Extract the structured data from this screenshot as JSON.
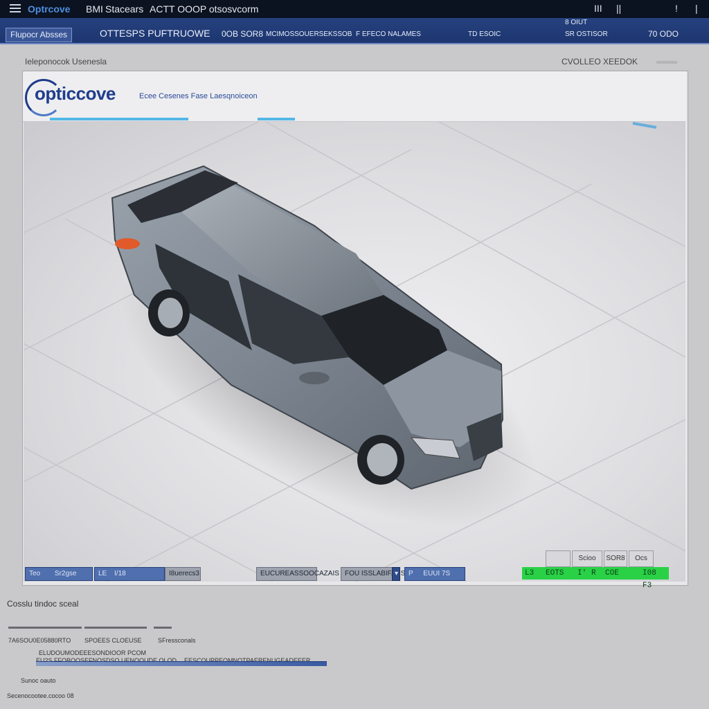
{
  "titlebar": {
    "app_name": "Optrcove",
    "menu_1": "BMI",
    "menu_2": "Stacears",
    "menu_3": "ACTT OOOP otsosvcorm",
    "controls": [
      "III",
      "||",
      "!",
      "|"
    ]
  },
  "toolbar": {
    "sub_status": "8 OIUT",
    "left_button": "Flupocr Absses",
    "title": "OTTESPS PUFTRUOWE",
    "item_1": "0OB SOR8",
    "item_2": "MCIMOSSOUERSEKSSOB",
    "item_3": "F EFECO NALAMES",
    "item_4": "TD ESOIC",
    "item_5": "SR OSTISOR",
    "item_6": "70 ODO"
  },
  "panel": {
    "title_left": "Ieleponocok Usenesla",
    "title_right": "CVOLLEO XEEDOK",
    "logo_word": "opticcove",
    "logo_tagline": "Ecee Cesenes Fase Laesqnoiceon"
  },
  "bottom_controls": {
    "c1_label": "Teo",
    "c1_value": "Sr2gse",
    "c2_label": "LE",
    "c2_value": "I/18",
    "c2_extra": "I8uerecs3",
    "c3": "EUCUREASSOOCAZAIS",
    "c4": "FOU ISSLABIFASS",
    "c5_label": "P",
    "c5_value": "EUUI 7S",
    "mini_1": "",
    "mini_2": "Scioo",
    "mini_3": "SOR8",
    "mini_4": "Ocs"
  },
  "green_status": {
    "a": "L3",
    "b": "EOTS",
    "c": "I'",
    "d": "R",
    "e": "COE",
    "f": "I08 F3"
  },
  "lower": {
    "title": "Cosslu tindoc sceal",
    "r1_c1": "7A6SOU0E05880RTO",
    "r1_c2": "SPOEES CLOEUSE",
    "r1_c3": "SFressconals",
    "r2": "ELUDOUMODEEESONDIOOR PCOM",
    "r3_left": "EU2S FFOBOOSEFNOSDSO UENOOUDE OLOD",
    "r3_right": "EESCOUPPEOMNOTPAERENUGEADEEER",
    "status": "Sunoc oauto",
    "footer": "Secenocootee.cocoo 08"
  },
  "colors": {
    "titlebar_bg": "#0b1220",
    "toolbar_bg": "#26417e",
    "brand": "#1f3d8c",
    "status_green": "#2ad146"
  },
  "icons": {
    "menu": "hamburger-icon",
    "logo": "opticcove-logo"
  }
}
